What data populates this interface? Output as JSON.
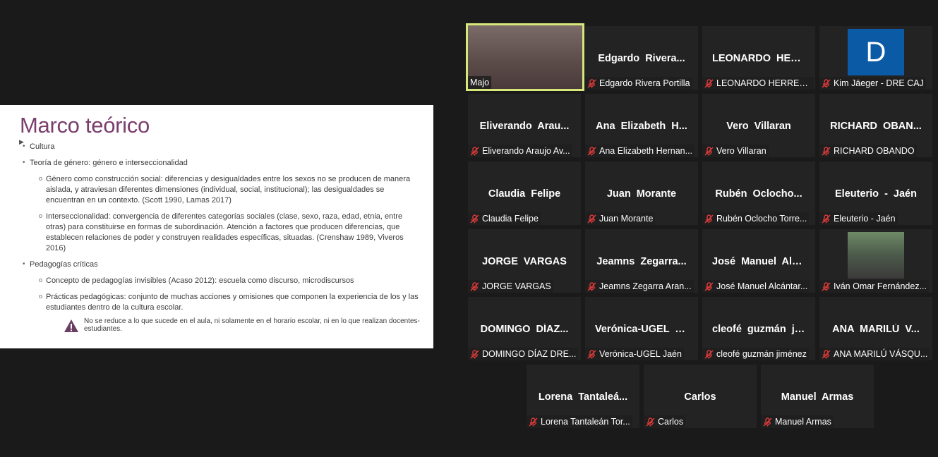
{
  "slide": {
    "title": "Marco teórico",
    "bullets": {
      "cultura": "Cultura",
      "genero": "Teoría de género: género e interseccionalidad",
      "genero_sub1": "Género como construcción social: diferencias y desigualdades entre los sexos no se producen de manera aislada, y  atraviesan diferentes dimensiones (individual, social, institucional); las desigualdades se encuentran en un contexto. (Scott 1990, Lamas 2017)",
      "genero_sub2": "Interseccionalidad: convergencia de diferentes categorías sociales (clase, sexo, raza, edad, etnia, entre otras) para constituirse en formas de subordinación. Atención a factores que producen diferencias, que establecen relaciones de poder y construyen realidades específicas, situadas. (Crenshaw 1989, Viveros 2016)",
      "pedagogias": "Pedagogías críticas",
      "ped_sub1": "Concepto de pedagogías invisibles (Acaso 2012): escuela como discurso, microdiscursos",
      "ped_sub2": "Prácticas pedagógicas: conjunto de muchas acciones y omisiones que componen la experiencia de los y las estudiantes dentro de la cultura escolar.",
      "warning": "No se reduce a lo que sucede en el aula, ni solamente en el horario escolar, ni en lo que realizan docentes- estudiantes."
    }
  },
  "participants": [
    {
      "name": "",
      "label": "Majo",
      "muted": false,
      "kind": "video"
    },
    {
      "name": "Edgardo Rivera...",
      "label": "Edgardo Rivera Portilla",
      "muted": true
    },
    {
      "name": "LEONARDO HER...",
      "label": "LEONARDO HERRER...",
      "muted": true
    },
    {
      "name": "",
      "label": "Kim Jäeger - DRE CAJ",
      "muted": true,
      "kind": "avatar",
      "initial": "D"
    },
    {
      "name": "Eliverando Arau...",
      "label": "Eliverando Araujo Av...",
      "muted": true
    },
    {
      "name": "Ana Elizabeth H...",
      "label": "Ana Elizabeth Hernan...",
      "muted": true
    },
    {
      "name": "Vero Villaran",
      "label": "Vero Villaran",
      "muted": true
    },
    {
      "name": "RICHARD OBAN...",
      "label": "RICHARD OBANDO",
      "muted": true
    },
    {
      "name": "Claudia Felipe",
      "label": "Claudia Felipe",
      "muted": true
    },
    {
      "name": "Juan Morante",
      "label": "Juan Morante",
      "muted": true
    },
    {
      "name": "Rubén Oclocho...",
      "label": "Rubén Oclocho Torre...",
      "muted": true
    },
    {
      "name": "Eleuterio - Jaén",
      "label": "Eleuterio - Jaén",
      "muted": true
    },
    {
      "name": "JORGE VARGAS",
      "label": "JORGE VARGAS",
      "muted": true
    },
    {
      "name": "Jeamns Zegarra...",
      "label": "Jeamns Zegarra Aran...",
      "muted": true
    },
    {
      "name": "José Manuel Alc...",
      "label": "José Manuel Alcántar...",
      "muted": true
    },
    {
      "name": "",
      "label": "Iván Omar Fernández...",
      "muted": true,
      "kind": "photo"
    },
    {
      "name": "DOMINGO DÍAZ...",
      "label": "DOMINGO DÍAZ DRE...",
      "muted": true
    },
    {
      "name": "Verónica-UGEL J...",
      "label": "Verónica-UGEL Jaén",
      "muted": true
    },
    {
      "name": "cleofé guzmán ji...",
      "label": "cleofé guzmán jiménez",
      "muted": true
    },
    {
      "name": "ANA MARILÚ V...",
      "label": "ANA MARILÚ VÁSQU...",
      "muted": true
    },
    {
      "name": "Lorena Tantaleá...",
      "label": "Lorena Tantaleán Tor...",
      "muted": true
    },
    {
      "name": "Carlos",
      "label": "Carlos",
      "muted": true
    },
    {
      "name": "Manuel Armas",
      "label": "Manuel Armas",
      "muted": true
    }
  ]
}
